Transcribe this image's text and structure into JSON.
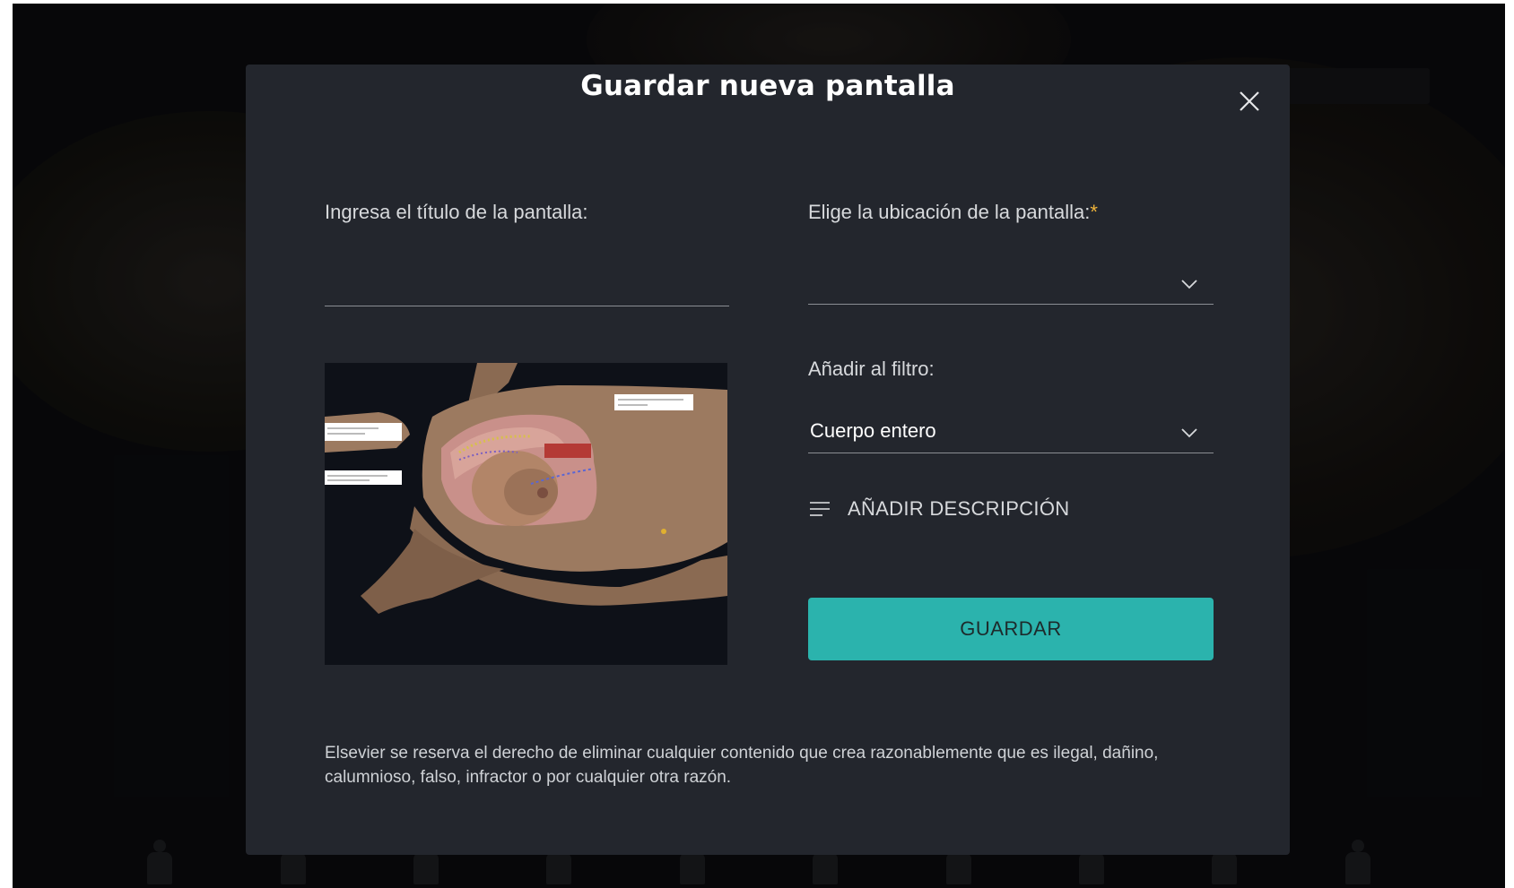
{
  "modal": {
    "title": "Guardar nueva pantalla",
    "title_field": {
      "label": "Ingresa el título de la pantalla:",
      "value": "",
      "placeholder": ""
    },
    "location_field": {
      "label": "Elige la ubicación de la pantalla:",
      "required_mark": "*",
      "selected": ""
    },
    "filter_field": {
      "label": "Añadir al filtro:",
      "selected": "Cuerpo entero"
    },
    "add_description_label": "AÑADIR DESCRIPCIÓN",
    "save_label": "GUARDAR",
    "disclaimer": "Elsevier se reserva el derecho de eliminar cualquier contenido que crea razonablemente que es ilegal, dañino, calumnioso, falso, infractor o por cualquier otra razón."
  },
  "icons": {
    "close": "close-icon",
    "chevron": "chevron-down-icon",
    "description": "lines-icon"
  },
  "colors": {
    "modal_bg": "#23262d",
    "accent": "#2bb3ad",
    "required": "#f0b43a"
  }
}
